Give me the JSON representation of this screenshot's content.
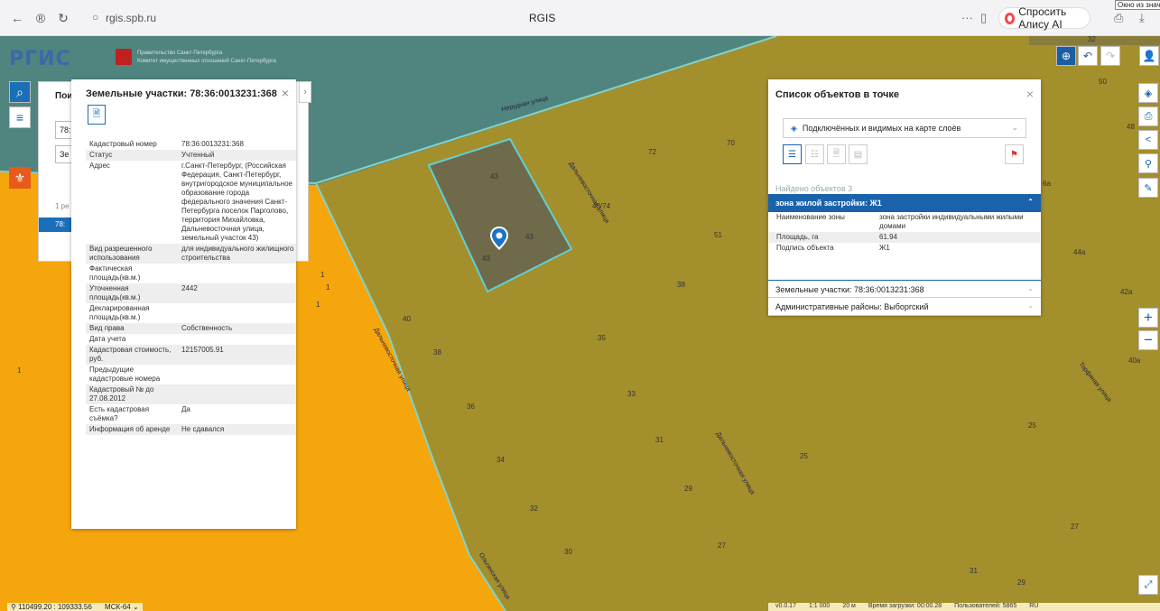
{
  "browser": {
    "url": "rgis.spb.ru",
    "tab_title": "RGIS",
    "alisa_label": "Спросить Алису AI",
    "corner_tooltip": "Окно из значе",
    "menu_dots": "···"
  },
  "header": {
    "logo": "РГИС",
    "gov_line1": "Правительство Санкт-Петербурга",
    "gov_line2": "Комитет имущественных отношений Санкт-Петербурга"
  },
  "search_panel": {
    "tab_label": "Пои",
    "cad_input_value": "78:",
    "type_input_value": "Зе",
    "page_text": "1 ре",
    "selected_row": "78:"
  },
  "parcel_card": {
    "title": "Земельные участки: 78:36:0013231:368",
    "close": "×",
    "rows": [
      {
        "k": "Кадастровый номер",
        "v": "78:36:0013231:368"
      },
      {
        "k": "Статус",
        "v": "Учтенный"
      },
      {
        "k": "Адрес",
        "v": "г.Санкт-Петербург, (Российская Федерация, Санкт-Петербург, внутригородское муниципальное образование города федерального значения Санкт-Петербурга поселок Парголово, территория Михайловка, Дальневосточная улица, земельный участок 43)"
      },
      {
        "k": "Вид разрешенного использования",
        "v": "для индивидуального жилищного строительства"
      },
      {
        "k": "Фактическая площадь(кв.м.)",
        "v": ""
      },
      {
        "k": "Уточненная площадь(кв.м.)",
        "v": "2442"
      },
      {
        "k": "Декларированная площадь(кв.м.)",
        "v": ""
      },
      {
        "k": "Вид права",
        "v": "Собственность"
      },
      {
        "k": "Дата учета",
        "v": ""
      },
      {
        "k": "Кадастровая стоимость, руб.",
        "v": "12157005.91"
      },
      {
        "k": "Предыдущие кадастровые номера",
        "v": ""
      },
      {
        "k": "Кадастровый № до 27.08.2012",
        "v": ""
      },
      {
        "k": "Есть кадастровая съёмка?",
        "v": "Да"
      },
      {
        "k": "Информация об аренде",
        "v": "Не сдавался"
      }
    ]
  },
  "objects_panel": {
    "title": "Список объектов в точке",
    "close": "×",
    "layer_select": "Подключённых и видимых на карте слоёв",
    "found_text": "Найдено объектов 3",
    "zone_row": "зона жилой застройки: Ж1",
    "zone_details": [
      {
        "k": "Наименование зоны",
        "v": "зона застройки индивидуальными жилыми домами"
      },
      {
        "k": "Площадь, га",
        "v": "61.94"
      },
      {
        "k": "Подпись объекта",
        "v": "Ж1"
      }
    ],
    "land_row": "Земельные участки: 78:36:0013231:368",
    "admin_row": "Административные районы: Выборгский"
  },
  "map_labels": {
    "numbers": [
      "43",
      "43",
      "43",
      "72",
      "40/74",
      "70",
      "51",
      "38",
      "1",
      "1",
      "1",
      "40",
      "38",
      "35",
      "33",
      "36",
      "31",
      "34",
      "29",
      "32",
      "30",
      "27",
      "25",
      "25",
      "27",
      "29",
      "31",
      "50",
      "48",
      "44а",
      "42а",
      "40а",
      "6а",
      "1",
      "32"
    ],
    "streets": [
      "Дальневосточная улица",
      "Дальневосточная улица",
      "Дальневосточная улица",
      "Торфяная улица",
      "Нерудная улица",
      "Ольгинская улица"
    ]
  },
  "status_bar": {
    "coords": "110499.20 : 109333.56",
    "crs": "МСК-64",
    "version": "v0.0.17",
    "scale": "1:1 000",
    "scale_bar": "20 м",
    "load_time": "Время загрузки: 00:00.28",
    "users": "Пользователей: 5865",
    "lang": "RU"
  },
  "colors": {
    "zone_olive": "#a38f2c",
    "zone_orange": "#f5a60c",
    "zone_teal": "#4f857e",
    "accent": "#1a62ac"
  }
}
